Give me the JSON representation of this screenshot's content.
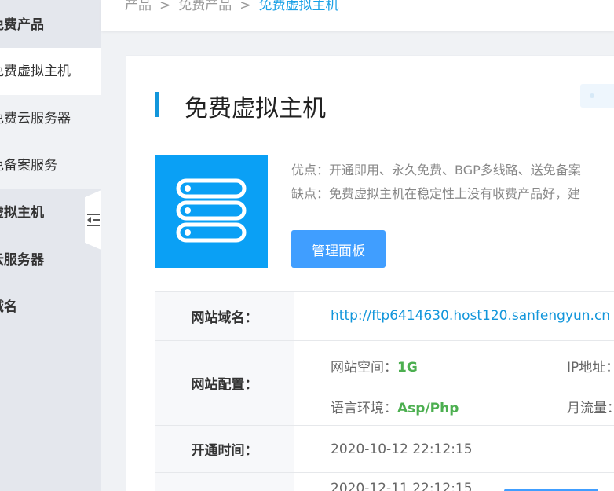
{
  "sidebar": {
    "items": [
      {
        "label": "免费产品"
      },
      {
        "label": "免费虚拟主机"
      },
      {
        "label": "免费云服务器"
      },
      {
        "label": "免备案服务"
      },
      {
        "label": "虚拟主机"
      },
      {
        "label": "云服务器"
      },
      {
        "label": "域名"
      }
    ]
  },
  "breadcrumb": {
    "items": [
      "产品",
      "免费产品",
      "免费虚拟主机"
    ],
    "separator": ">"
  },
  "page": {
    "title": "免费虚拟主机",
    "pros": "优点：开通即用、永久免费、BGP多线路、送免备案",
    "cons": "缺点：免费虚拟主机在稳定性上没有收费产品好，建",
    "manage_label": "管理面板"
  },
  "info": {
    "domain_label": "网站域名：",
    "domain_value": "http://ftp6414630.host120.sanfengyun.cn",
    "config_label": "网站配置：",
    "space_label": "网站空间：",
    "space_value": "1G",
    "lang_label": "语言环境：",
    "lang_value": "Asp/Php",
    "ip_label": "IP地址：",
    "traffic_label": "月流量：",
    "open_label": "开通时间：",
    "open_value": "2020-10-12 22:12:15",
    "expire_value": "2020-12-11 22:12:15"
  },
  "colors": {
    "accent": "#1296db",
    "button": "#409eff",
    "highlight": "#4caf50"
  },
  "icons": {
    "server": "server-icon",
    "collapse": "collapse-menu-icon"
  }
}
